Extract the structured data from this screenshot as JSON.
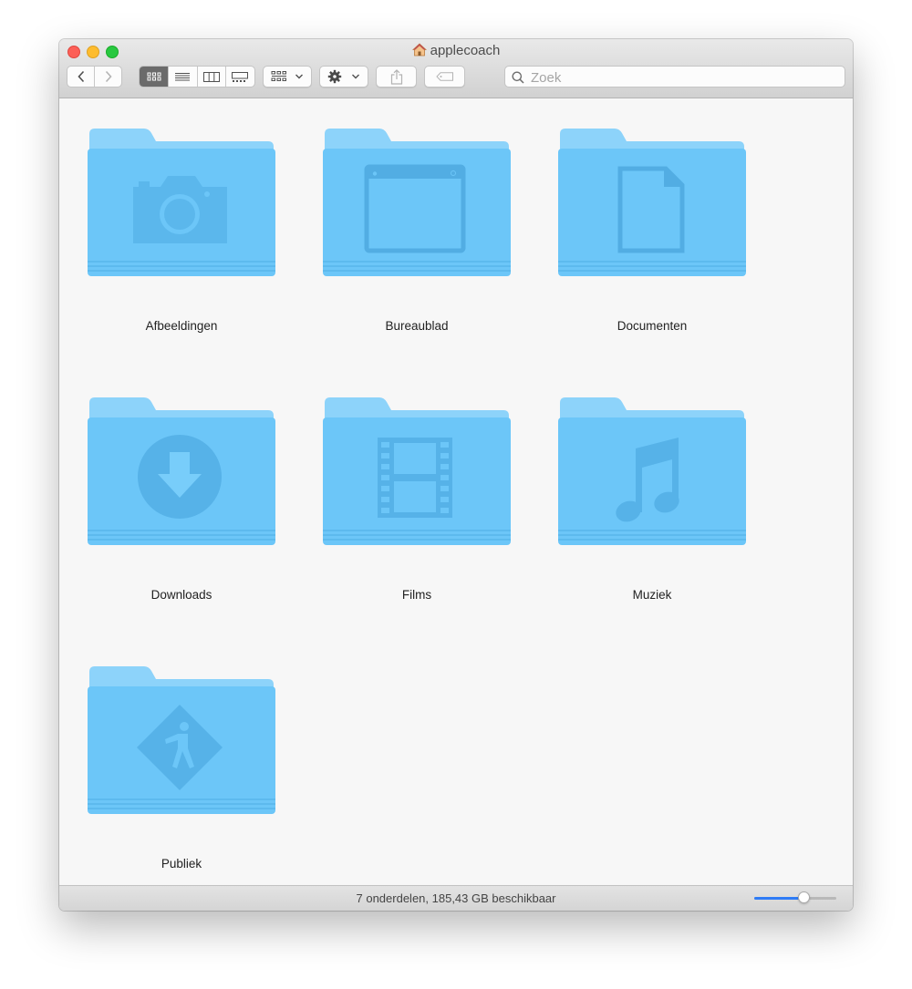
{
  "window": {
    "title": "applecoach"
  },
  "toolbar": {
    "back_icon": "chevron-left-icon",
    "forward_icon": "chevron-right-icon",
    "views": [
      "icon-view",
      "list-view",
      "column-view",
      "gallery-view"
    ],
    "active_view": "icon-view",
    "group_icon": "group-grid-icon",
    "action_icon": "gear-icon",
    "share_icon": "share-icon",
    "tag_icon": "tag-icon"
  },
  "search": {
    "placeholder": "Zoek",
    "value": ""
  },
  "folders": [
    {
      "label": "Afbeeldingen",
      "icon": "camera-icon"
    },
    {
      "label": "Bureaublad",
      "icon": "desktop-window-icon"
    },
    {
      "label": "Documenten",
      "icon": "document-icon"
    },
    {
      "label": "Downloads",
      "icon": "download-arrow-icon"
    },
    {
      "label": "Films",
      "icon": "film-strip-icon"
    },
    {
      "label": "Muziek",
      "icon": "music-note-icon"
    },
    {
      "label": "Publiek",
      "icon": "public-sign-icon"
    }
  ],
  "status": {
    "text": "7 onderdelen, 185,43 GB beschikbaar",
    "icon_size_level": 0.6
  },
  "colors": {
    "folder_back": "#8dd3fa",
    "folder_front": "#6cc6f8",
    "glyph": "#4fb0e6",
    "accent": "#2f7cf6"
  }
}
